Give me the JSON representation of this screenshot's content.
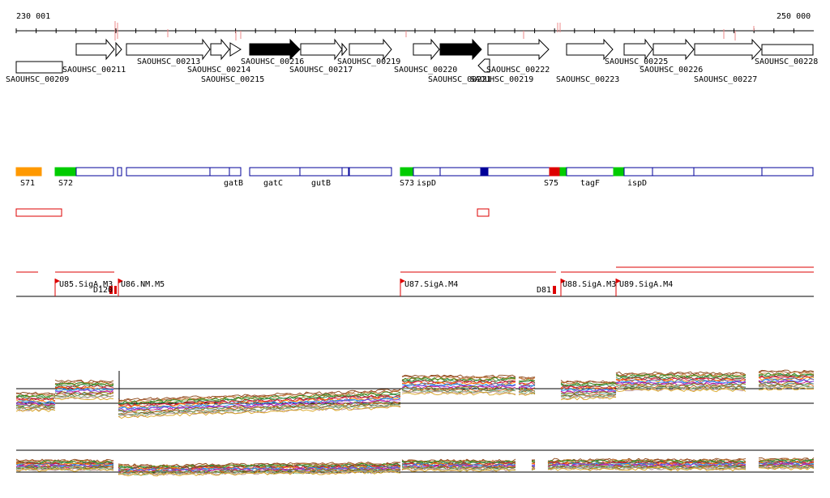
{
  "axis": {
    "start_label": "230 001",
    "end_label": "250 000"
  },
  "genes": [
    {
      "label": "SAOUHSC_00209",
      "strand": "none",
      "fill": "white"
    },
    {
      "label": "SAOUHSC_00211",
      "strand": "+",
      "fill": "white"
    },
    {
      "label": "SAOUHSC_00213",
      "strand": "+",
      "fill": "white"
    },
    {
      "label": "SAOUHSC_00214",
      "strand": "+",
      "fill": "white"
    },
    {
      "label": "SAOUHSC_00215",
      "strand": "+",
      "fill": "white"
    },
    {
      "label": "SAOUHSC_00216",
      "strand": "+",
      "fill": "black"
    },
    {
      "label": "SAOUHSC_00217",
      "strand": "+",
      "fill": "white"
    },
    {
      "label": "SAOUHSC_00219",
      "strand": "+",
      "fill": "white"
    },
    {
      "label": "SAOUHSC_00220",
      "strand": "+",
      "fill": "white"
    },
    {
      "label": "SAOUHSC_00221",
      "strand": "+",
      "fill": "black"
    },
    {
      "label": "SAOUHSC_00219",
      "strand": "-",
      "fill": "white"
    },
    {
      "label": "SAOUHSC_00222",
      "strand": "+",
      "fill": "white"
    },
    {
      "label": "SAOUHSC_00223",
      "strand": "+",
      "fill": "white"
    },
    {
      "label": "SAOUHSC_00225",
      "strand": "+",
      "fill": "white"
    },
    {
      "label": "SAOUHSC_00226",
      "strand": "+",
      "fill": "white"
    },
    {
      "label": "SAOUHSC_00227",
      "strand": "+",
      "fill": "white"
    },
    {
      "label": "SAOUHSC_00228",
      "strand": "none",
      "fill": "white"
    }
  ],
  "segment_labels": [
    "S71",
    "S72",
    "gatB",
    "gatC",
    "gutB",
    "S73",
    "ispD",
    "S75",
    "tagF",
    "ispD"
  ],
  "segment_colors": {
    "orange": "#ff9900",
    "green": "#00cc00",
    "red": "#dd0000",
    "navy": "#000099"
  },
  "promoters": [
    {
      "label": "U85.SigA.M3"
    },
    {
      "label": "D120"
    },
    {
      "label": "U86.NM.M5"
    },
    {
      "label": "U87.SigA.M4"
    },
    {
      "label": "D81"
    },
    {
      "label": "U88.SigA.M3"
    },
    {
      "label": "U89.SigA.M4"
    }
  ],
  "colors": {
    "feature_red": "#dd0000",
    "gene_outline": "#000000",
    "segment_outline": "#000099"
  }
}
